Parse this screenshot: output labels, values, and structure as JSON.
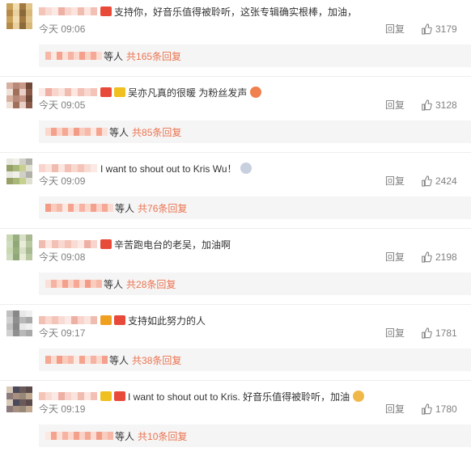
{
  "colors": {
    "accent": "#eb7350",
    "muted": "#808080",
    "sub_bg": "#f5f5f5"
  },
  "labels": {
    "reply": "回复",
    "others": "等人"
  },
  "comments": [
    {
      "text": "支持你，好音乐值得被聆听，这张专辑确实根棒，加油，",
      "time": "今天 09:06",
      "likes": "3179",
      "replies": "共165条回复",
      "emoji": ""
    },
    {
      "text": "吴亦凡真的很暖 为粉丝发声",
      "time": "今天 09:05",
      "likes": "3128",
      "replies": "共85条回复",
      "emoji": "hugging-face-icon"
    },
    {
      "text": "I want to shout out to Kris Wu！",
      "time": "今天 09:09",
      "likes": "2424",
      "replies": "共76条回复",
      "emoji": "sparkle-icon"
    },
    {
      "text": "辛苦跑电台的老吴，加油啊",
      "time": "今天 09:08",
      "likes": "2198",
      "replies": "共28条回复",
      "emoji": ""
    },
    {
      "text": "支持如此努力的人",
      "time": "今天 09:17",
      "likes": "1781",
      "replies": "共38条回复",
      "emoji": ""
    },
    {
      "text": "I want to shout out to Kris. 好音乐值得被聆听，加油",
      "time": "今天 09:19",
      "likes": "1780",
      "replies": "共10条回复",
      "emoji": "flexed-biceps-icon"
    }
  ]
}
